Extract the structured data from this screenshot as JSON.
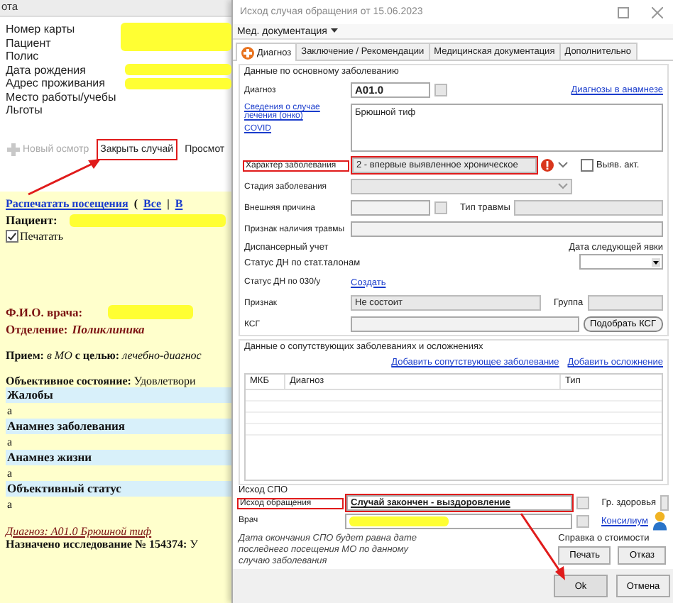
{
  "left": {
    "header_fragment": "ота",
    "patient_fields": [
      "Номер карты",
      "Пациент",
      "Полис",
      "Дата рождения",
      "Адрес проживания",
      "Место работы/учебы",
      "Льготы"
    ],
    "toolbar": [
      {
        "label": "Новый осмотр",
        "disabled": true,
        "highlighted": false
      },
      {
        "label": "Закрыть случай",
        "disabled": false,
        "highlighted": true
      },
      {
        "label": "Просмот",
        "disabled": false,
        "highlighted": false
      }
    ],
    "print_link": "Распечатать посещения",
    "print_open": "(",
    "print_all": "Все",
    "print_sep": "|",
    "print_next": "В",
    "patient_label": "Пациент:",
    "print_checkbox": {
      "label": "Печатать",
      "checked": true
    },
    "doctor_label": "Ф.И.О. врача:",
    "department_label": "Отделение:",
    "department_value": "Поликлиника",
    "reception": "**Прием:** *в МО* **с целью:** *лечебно-диагнос*",
    "objective": "**Объективное состояние:** Удовлетвори",
    "sections": [
      {
        "title": "Жалобы",
        "text": "a"
      },
      {
        "title": "Анамнез заболевания",
        "text": "a"
      },
      {
        "title": "Анамнез жизни",
        "text": "a"
      },
      {
        "title": "Объективный статус",
        "text": "a"
      }
    ],
    "diagnosis": "Диагноз: A01.0 Брюшной тиф",
    "assigned": "**Назначено исследование № 154374:** У"
  },
  "dialog": {
    "title": "Исход случая обращения от 15.06.2023",
    "menu": "Мед. документация",
    "tabs": [
      {
        "label": "Диагноз",
        "selected": true
      },
      {
        "label": "Заключение / Рекомендации",
        "selected": false
      },
      {
        "label": "Медицинская документация",
        "selected": false
      },
      {
        "label": "Дополнительно",
        "selected": false
      }
    ],
    "main_group": "Данные по основному заболеванию",
    "diagnosis_label": "Диагноз",
    "diagnosis_code": "A01.0",
    "history_link": "Диагнозы в анамнезе",
    "onco_link": "Сведения о случае лечения (онко)",
    "covid_link": "COVID",
    "diagnosis_text": "Брюшной тиф",
    "nature_label": "Характер заболевания",
    "nature_value": "2 - впервые выявленное хроническое",
    "nature_highlighted": true,
    "acute_checkbox": {
      "label": "Выяв. акт.",
      "checked": false
    },
    "stage_label": "Стадия заболевания",
    "external_label": "Внешняя причина",
    "injury_type_label": "Тип травмы",
    "injury_sign_label": "Признак наличия травмы",
    "dispensary_label": "Диспансерный учет",
    "next_visit_label": "Дата следующей явки",
    "dn_stat_label": "Статус ДН по стат.талонам",
    "dn_030_label": "Статус ДН по 030/у",
    "create_link": "Создать",
    "sign_label": "Признак",
    "sign_value": "Не состоит",
    "group_label": "Группа",
    "ksg_label": "КСГ",
    "ksg_button": "Подобрать КСГ",
    "concomitant_group": "Данные о сопутствующих заболеваниях и осложнениях",
    "add_concomitant_link": "Добавить сопутствующее заболевание",
    "add_complication_link": "Добавить осложнение",
    "table_columns": [
      "МКБ",
      "Диагноз",
      "Тип"
    ],
    "spo_group": "Исход СПО",
    "outcome_label": "Исход обращения",
    "outcome_value": "Случай закончен - выздоровление",
    "outcome_highlighted": true,
    "health_group_label": "Гр. здоровья",
    "doctor_label": "Врач",
    "council_link": "Консилиум",
    "note": "Дата окончания СПО будет равна дате последнего посещения МО по данному случаю заболевания",
    "cost_group": "Справка о стоимости",
    "cost_buttons": [
      "Печать",
      "Отказ"
    ],
    "footer_buttons": [
      "Ok",
      "Отмена"
    ]
  }
}
